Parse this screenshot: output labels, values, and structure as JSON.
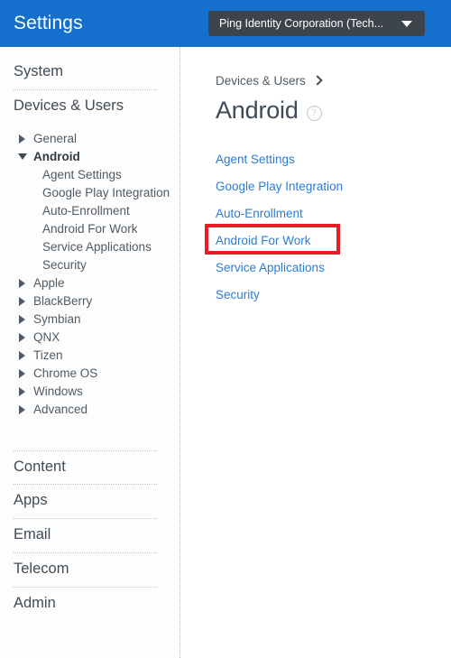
{
  "header": {
    "title": "Settings",
    "org_selector": {
      "value": "Ping Identity Corporation (Tech...",
      "caret_icon": "chevron-down-icon"
    },
    "accent_color": "#1470cc",
    "selector_bg": "#3d444b"
  },
  "sidebar": {
    "sections": [
      {
        "label": "System"
      },
      {
        "label": "Devices & Users"
      },
      {
        "label": "Content"
      },
      {
        "label": "Apps"
      },
      {
        "label": "Email"
      },
      {
        "label": "Telecom"
      },
      {
        "label": "Admin"
      }
    ],
    "tree": [
      {
        "label": "General",
        "expanded": false,
        "icon": "triangle-right-icon"
      },
      {
        "label": "Android",
        "expanded": true,
        "icon": "triangle-down-icon"
      },
      {
        "label": "Apple",
        "expanded": false,
        "icon": "triangle-right-icon"
      },
      {
        "label": "BlackBerry",
        "expanded": false,
        "icon": "triangle-right-icon"
      },
      {
        "label": "Symbian",
        "expanded": false,
        "icon": "triangle-right-icon"
      },
      {
        "label": "QNX",
        "expanded": false,
        "icon": "triangle-right-icon"
      },
      {
        "label": "Tizen",
        "expanded": false,
        "icon": "triangle-right-icon"
      },
      {
        "label": "Chrome OS",
        "expanded": false,
        "icon": "triangle-right-icon"
      },
      {
        "label": "Windows",
        "expanded": false,
        "icon": "triangle-right-icon"
      },
      {
        "label": "Advanced",
        "expanded": false,
        "icon": "triangle-right-icon"
      }
    ],
    "android_children": [
      {
        "label": "Agent Settings"
      },
      {
        "label": "Google Play Integration"
      },
      {
        "label": "Auto-Enrollment"
      },
      {
        "label": "Android For Work"
      },
      {
        "label": "Service Applications"
      },
      {
        "label": "Security"
      }
    ]
  },
  "main": {
    "breadcrumb": {
      "label": "Devices & Users",
      "chevron_icon": "chevron-right-icon"
    },
    "page_title": "Android",
    "help_icon": "question-mark-circle-icon",
    "help_glyph": "?",
    "links": [
      {
        "label": "Agent Settings",
        "highlighted": false
      },
      {
        "label": "Google Play Integration",
        "highlighted": false
      },
      {
        "label": "Auto-Enrollment",
        "highlighted": false
      },
      {
        "label": "Android For Work",
        "highlighted": true
      },
      {
        "label": "Service Applications",
        "highlighted": false
      },
      {
        "label": "Security",
        "highlighted": false
      }
    ],
    "link_color": "#2b7cd3",
    "highlight_color": "#ec1c24"
  }
}
